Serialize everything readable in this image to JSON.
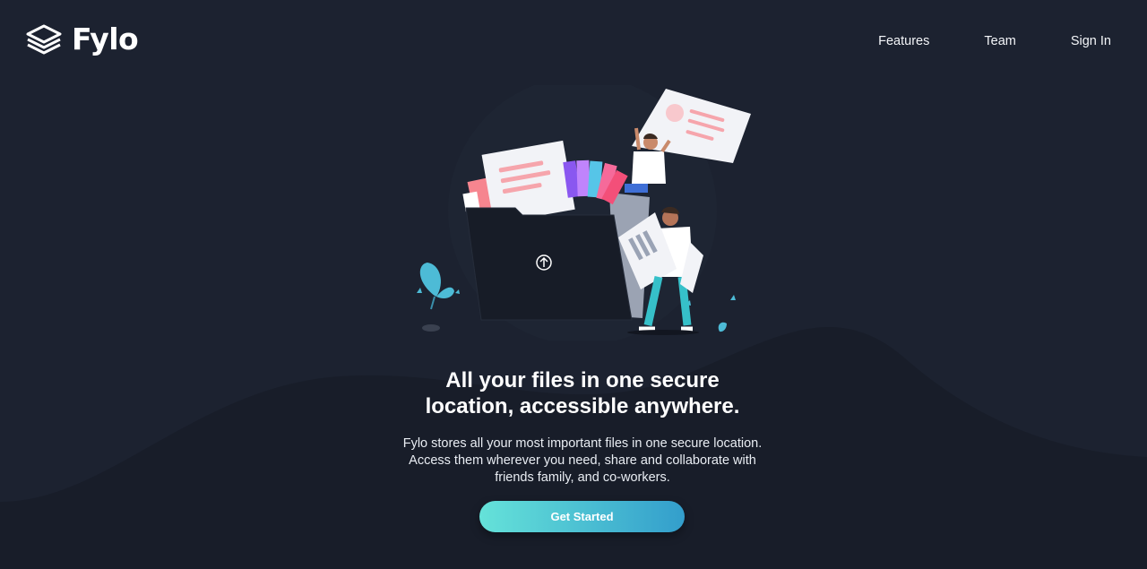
{
  "brand": {
    "name": "Fylo",
    "logo_icon": "stacked-layers-icon"
  },
  "nav": {
    "items": [
      {
        "label": "Features"
      },
      {
        "label": "Team"
      },
      {
        "label": "Sign In"
      }
    ]
  },
  "hero": {
    "illustration": "people-organizing-files-illustration",
    "upload_icon": "upload-arrow-icon",
    "title_line1": "All your files in one secure",
    "title_line2": "location, accessible anywhere.",
    "text_line1": "Fylo stores all your most important files in one secure location.",
    "text_line2": "Access them wherever you need, share and collaborate with",
    "text_line3": "friends family, and co-workers.",
    "cta_label": "Get Started"
  },
  "colors": {
    "background": "#1c2230",
    "wave": "#181d29",
    "cta_gradient_start": "#65e2d9",
    "cta_gradient_end": "#339ecc",
    "accent_pink": "#f6959e"
  }
}
